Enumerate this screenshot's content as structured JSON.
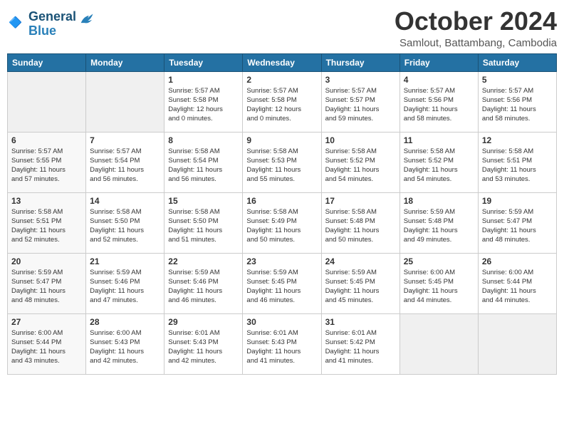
{
  "logo": {
    "line1": "General",
    "line2": "Blue"
  },
  "title": "October 2024",
  "location": "Samlout, Battambang, Cambodia",
  "weekdays": [
    "Sunday",
    "Monday",
    "Tuesday",
    "Wednesday",
    "Thursday",
    "Friday",
    "Saturday"
  ],
  "weeks": [
    [
      {
        "day": "",
        "info": ""
      },
      {
        "day": "",
        "info": ""
      },
      {
        "day": "1",
        "info": "Sunrise: 5:57 AM\nSunset: 5:58 PM\nDaylight: 12 hours\nand 0 minutes."
      },
      {
        "day": "2",
        "info": "Sunrise: 5:57 AM\nSunset: 5:58 PM\nDaylight: 12 hours\nand 0 minutes."
      },
      {
        "day": "3",
        "info": "Sunrise: 5:57 AM\nSunset: 5:57 PM\nDaylight: 11 hours\nand 59 minutes."
      },
      {
        "day": "4",
        "info": "Sunrise: 5:57 AM\nSunset: 5:56 PM\nDaylight: 11 hours\nand 58 minutes."
      },
      {
        "day": "5",
        "info": "Sunrise: 5:57 AM\nSunset: 5:56 PM\nDaylight: 11 hours\nand 58 minutes."
      }
    ],
    [
      {
        "day": "6",
        "info": "Sunrise: 5:57 AM\nSunset: 5:55 PM\nDaylight: 11 hours\nand 57 minutes."
      },
      {
        "day": "7",
        "info": "Sunrise: 5:57 AM\nSunset: 5:54 PM\nDaylight: 11 hours\nand 56 minutes."
      },
      {
        "day": "8",
        "info": "Sunrise: 5:58 AM\nSunset: 5:54 PM\nDaylight: 11 hours\nand 56 minutes."
      },
      {
        "day": "9",
        "info": "Sunrise: 5:58 AM\nSunset: 5:53 PM\nDaylight: 11 hours\nand 55 minutes."
      },
      {
        "day": "10",
        "info": "Sunrise: 5:58 AM\nSunset: 5:52 PM\nDaylight: 11 hours\nand 54 minutes."
      },
      {
        "day": "11",
        "info": "Sunrise: 5:58 AM\nSunset: 5:52 PM\nDaylight: 11 hours\nand 54 minutes."
      },
      {
        "day": "12",
        "info": "Sunrise: 5:58 AM\nSunset: 5:51 PM\nDaylight: 11 hours\nand 53 minutes."
      }
    ],
    [
      {
        "day": "13",
        "info": "Sunrise: 5:58 AM\nSunset: 5:51 PM\nDaylight: 11 hours\nand 52 minutes."
      },
      {
        "day": "14",
        "info": "Sunrise: 5:58 AM\nSunset: 5:50 PM\nDaylight: 11 hours\nand 52 minutes."
      },
      {
        "day": "15",
        "info": "Sunrise: 5:58 AM\nSunset: 5:50 PM\nDaylight: 11 hours\nand 51 minutes."
      },
      {
        "day": "16",
        "info": "Sunrise: 5:58 AM\nSunset: 5:49 PM\nDaylight: 11 hours\nand 50 minutes."
      },
      {
        "day": "17",
        "info": "Sunrise: 5:58 AM\nSunset: 5:48 PM\nDaylight: 11 hours\nand 50 minutes."
      },
      {
        "day": "18",
        "info": "Sunrise: 5:59 AM\nSunset: 5:48 PM\nDaylight: 11 hours\nand 49 minutes."
      },
      {
        "day": "19",
        "info": "Sunrise: 5:59 AM\nSunset: 5:47 PM\nDaylight: 11 hours\nand 48 minutes."
      }
    ],
    [
      {
        "day": "20",
        "info": "Sunrise: 5:59 AM\nSunset: 5:47 PM\nDaylight: 11 hours\nand 48 minutes."
      },
      {
        "day": "21",
        "info": "Sunrise: 5:59 AM\nSunset: 5:46 PM\nDaylight: 11 hours\nand 47 minutes."
      },
      {
        "day": "22",
        "info": "Sunrise: 5:59 AM\nSunset: 5:46 PM\nDaylight: 11 hours\nand 46 minutes."
      },
      {
        "day": "23",
        "info": "Sunrise: 5:59 AM\nSunset: 5:45 PM\nDaylight: 11 hours\nand 46 minutes."
      },
      {
        "day": "24",
        "info": "Sunrise: 5:59 AM\nSunset: 5:45 PM\nDaylight: 11 hours\nand 45 minutes."
      },
      {
        "day": "25",
        "info": "Sunrise: 6:00 AM\nSunset: 5:45 PM\nDaylight: 11 hours\nand 44 minutes."
      },
      {
        "day": "26",
        "info": "Sunrise: 6:00 AM\nSunset: 5:44 PM\nDaylight: 11 hours\nand 44 minutes."
      }
    ],
    [
      {
        "day": "27",
        "info": "Sunrise: 6:00 AM\nSunset: 5:44 PM\nDaylight: 11 hours\nand 43 minutes."
      },
      {
        "day": "28",
        "info": "Sunrise: 6:00 AM\nSunset: 5:43 PM\nDaylight: 11 hours\nand 42 minutes."
      },
      {
        "day": "29",
        "info": "Sunrise: 6:01 AM\nSunset: 5:43 PM\nDaylight: 11 hours\nand 42 minutes."
      },
      {
        "day": "30",
        "info": "Sunrise: 6:01 AM\nSunset: 5:43 PM\nDaylight: 11 hours\nand 41 minutes."
      },
      {
        "day": "31",
        "info": "Sunrise: 6:01 AM\nSunset: 5:42 PM\nDaylight: 11 hours\nand 41 minutes."
      },
      {
        "day": "",
        "info": ""
      },
      {
        "day": "",
        "info": ""
      }
    ]
  ]
}
